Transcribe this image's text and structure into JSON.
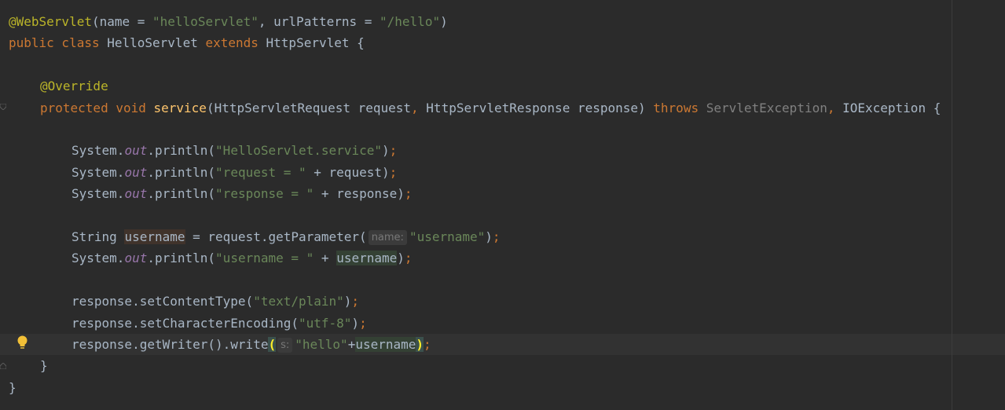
{
  "editor": {
    "lines": [
      {
        "indent": 0,
        "current": false,
        "tokens": [
          {
            "t": "@WebServlet",
            "c": "ann"
          },
          {
            "t": "(name = "
          },
          {
            "t": "\"helloServlet\"",
            "c": "str"
          },
          {
            "t": ", urlPatterns = "
          },
          {
            "t": "\"/hello\"",
            "c": "str"
          },
          {
            "t": ")"
          }
        ]
      },
      {
        "indent": 0,
        "current": false,
        "tokens": [
          {
            "t": "public class ",
            "c": "kw"
          },
          {
            "t": "HelloServlet "
          },
          {
            "t": "extends ",
            "c": "kw"
          },
          {
            "t": "HttpServlet {"
          }
        ]
      },
      {
        "indent": 0,
        "current": false,
        "tokens": []
      },
      {
        "indent": 1,
        "current": false,
        "tokens": [
          {
            "t": "@Override",
            "c": "ann"
          }
        ]
      },
      {
        "indent": 1,
        "current": false,
        "tokens": [
          {
            "t": "protected void ",
            "c": "kw"
          },
          {
            "t": "service",
            "c": "meth"
          },
          {
            "t": "(HttpServletRequest request"
          },
          {
            "t": ", ",
            "c": "kw"
          },
          {
            "t": "HttpServletResponse response) "
          },
          {
            "t": "throws ",
            "c": "kw"
          },
          {
            "t": "ServletException",
            "c": "grey"
          },
          {
            "t": ", ",
            "c": "kw"
          },
          {
            "t": "IOException {"
          }
        ]
      },
      {
        "indent": 0,
        "current": false,
        "tokens": []
      },
      {
        "indent": 2,
        "current": false,
        "tokens": [
          {
            "t": "System."
          },
          {
            "t": "out",
            "c": "fld"
          },
          {
            "t": ".println("
          },
          {
            "t": "\"HelloServlet.service\"",
            "c": "str"
          },
          {
            "t": ")"
          },
          {
            "t": ";",
            "c": "kw"
          }
        ]
      },
      {
        "indent": 2,
        "current": false,
        "tokens": [
          {
            "t": "System."
          },
          {
            "t": "out",
            "c": "fld"
          },
          {
            "t": ".println("
          },
          {
            "t": "\"request = \"",
            "c": "str"
          },
          {
            "t": " + request)"
          },
          {
            "t": ";",
            "c": "kw"
          }
        ]
      },
      {
        "indent": 2,
        "current": false,
        "tokens": [
          {
            "t": "System."
          },
          {
            "t": "out",
            "c": "fld"
          },
          {
            "t": ".println("
          },
          {
            "t": "\"response = \"",
            "c": "str"
          },
          {
            "t": " + response)"
          },
          {
            "t": ";",
            "c": "kw"
          }
        ]
      },
      {
        "indent": 0,
        "current": false,
        "tokens": []
      },
      {
        "indent": 2,
        "current": false,
        "tokens": [
          {
            "t": "String "
          },
          {
            "t": "username",
            "c": "var-write"
          },
          {
            "t": " = request.getParameter("
          },
          {
            "t": "name:",
            "c": "hint"
          },
          {
            "t": "\"username\"",
            "c": "str"
          },
          {
            "t": ")"
          },
          {
            "t": ";",
            "c": "kw"
          }
        ]
      },
      {
        "indent": 2,
        "current": false,
        "tokens": [
          {
            "t": "System."
          },
          {
            "t": "out",
            "c": "fld"
          },
          {
            "t": ".println("
          },
          {
            "t": "\"username = \"",
            "c": "str"
          },
          {
            "t": " + "
          },
          {
            "t": "username",
            "c": "var-read"
          },
          {
            "t": ")"
          },
          {
            "t": ";",
            "c": "kw"
          }
        ]
      },
      {
        "indent": 0,
        "current": false,
        "tokens": []
      },
      {
        "indent": 2,
        "current": false,
        "tokens": [
          {
            "t": "response.setContentType("
          },
          {
            "t": "\"text/plain\"",
            "c": "str"
          },
          {
            "t": ")"
          },
          {
            "t": ";",
            "c": "kw"
          }
        ]
      },
      {
        "indent": 2,
        "current": false,
        "tokens": [
          {
            "t": "response.setCharacterEncoding("
          },
          {
            "t": "\"utf-8\"",
            "c": "str"
          },
          {
            "t": ")"
          },
          {
            "t": ";",
            "c": "kw"
          }
        ]
      },
      {
        "indent": 2,
        "current": true,
        "tokens": [
          {
            "t": "response.getWriter().write"
          },
          {
            "t": "(",
            "c": "brace-match"
          },
          {
            "t": "s:",
            "c": "hint"
          },
          {
            "t": "\"hello\"",
            "c": "str"
          },
          {
            "t": "+"
          },
          {
            "t": "username",
            "c": "var-read"
          },
          {
            "t": ")",
            "c": "brace-match"
          },
          {
            "t": ";",
            "c": "kw"
          }
        ]
      },
      {
        "indent": 1,
        "current": false,
        "tokens": [
          {
            "t": "}"
          }
        ]
      },
      {
        "indent": 0,
        "current": false,
        "tokens": [
          {
            "t": "}"
          }
        ]
      }
    ]
  },
  "gutter": {
    "intention_icon": "lightbulb-icon",
    "fold_icon": "fold-marker-icon"
  },
  "colors": {
    "background": "#2b2b2b",
    "keyword": "#cc7832",
    "string": "#6a8759",
    "annotation": "#bbb529",
    "method": "#ffc66d",
    "static_field": "#9876aa",
    "text": "#a9b7c6"
  }
}
